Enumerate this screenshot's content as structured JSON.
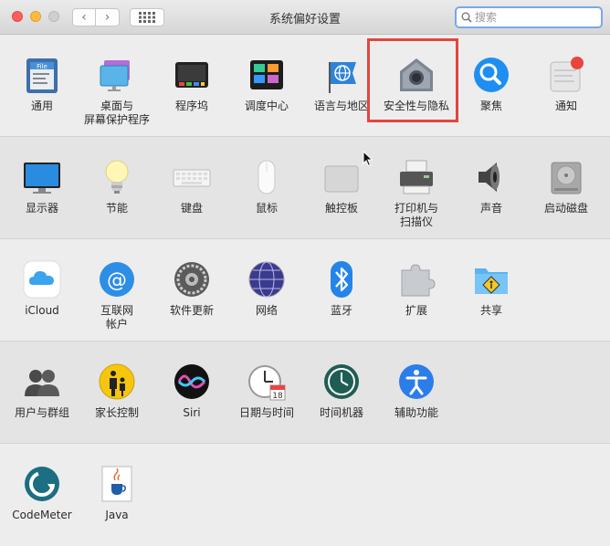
{
  "window": {
    "title": "系统偏好设置"
  },
  "search": {
    "placeholder": "搜索",
    "value": ""
  },
  "colors": {
    "highlight": "#e2463d",
    "search_focus": "#7aa7ea"
  },
  "rows": [
    [
      {
        "label": "通用",
        "icon": "general-icon"
      },
      {
        "label": "桌面与\n屏幕保护程序",
        "icon": "desktop-screensaver-icon"
      },
      {
        "label": "程序坞",
        "icon": "dock-icon"
      },
      {
        "label": "调度中心",
        "icon": "mission-control-icon"
      },
      {
        "label": "语言与地区",
        "icon": "language-region-icon"
      },
      {
        "label": "安全性与隐私",
        "icon": "security-privacy-icon"
      },
      {
        "label": "聚焦",
        "icon": "spotlight-icon"
      },
      {
        "label": "通知",
        "icon": "notifications-icon"
      }
    ],
    [
      {
        "label": "显示器",
        "icon": "displays-icon"
      },
      {
        "label": "节能",
        "icon": "energy-saver-icon"
      },
      {
        "label": "键盘",
        "icon": "keyboard-icon"
      },
      {
        "label": "鼠标",
        "icon": "mouse-icon"
      },
      {
        "label": "触控板",
        "icon": "trackpad-icon"
      },
      {
        "label": "打印机与\n扫描仪",
        "icon": "printers-scanners-icon"
      },
      {
        "label": "声音",
        "icon": "sound-icon"
      },
      {
        "label": "启动磁盘",
        "icon": "startup-disk-icon"
      }
    ],
    [
      {
        "label": "iCloud",
        "icon": "icloud-icon"
      },
      {
        "label": "互联网\n帐户",
        "icon": "internet-accounts-icon"
      },
      {
        "label": "软件更新",
        "icon": "software-update-icon"
      },
      {
        "label": "网络",
        "icon": "network-icon"
      },
      {
        "label": "蓝牙",
        "icon": "bluetooth-icon"
      },
      {
        "label": "扩展",
        "icon": "extensions-icon"
      },
      {
        "label": "共享",
        "icon": "sharing-icon"
      }
    ],
    [
      {
        "label": "用户与群组",
        "icon": "users-groups-icon"
      },
      {
        "label": "家长控制",
        "icon": "parental-controls-icon"
      },
      {
        "label": "Siri",
        "icon": "siri-icon"
      },
      {
        "label": "日期与时间",
        "icon": "date-time-icon"
      },
      {
        "label": "时间机器",
        "icon": "time-machine-icon"
      },
      {
        "label": "辅助功能",
        "icon": "accessibility-icon"
      }
    ],
    [
      {
        "label": "CodeMeter",
        "icon": "codemeter-icon"
      },
      {
        "label": "Java",
        "icon": "java-icon"
      }
    ]
  ]
}
